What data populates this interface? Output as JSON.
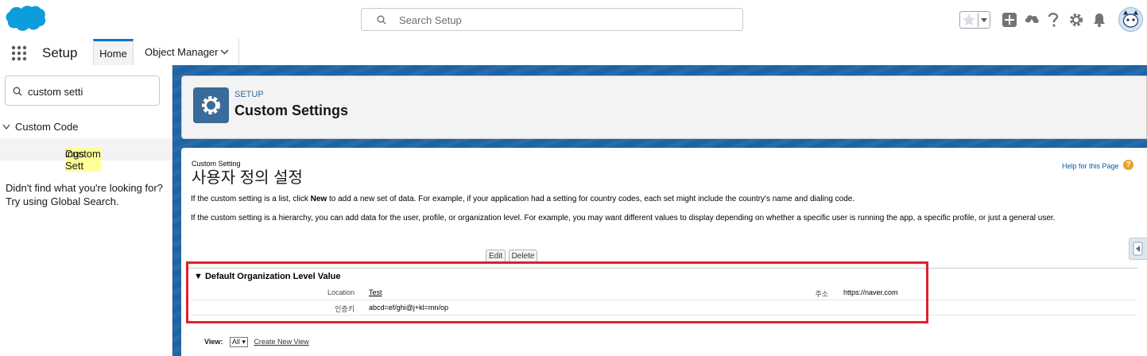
{
  "header": {
    "search_placeholder": "Search Setup",
    "icons": [
      "favorites-star-icon",
      "favorites-dropdown-icon",
      "add-icon",
      "trailhead-icon",
      "help-icon",
      "setup-gear-icon",
      "notifications-bell-icon",
      "user-avatar"
    ]
  },
  "nav": {
    "app_title": "Setup",
    "tabs": [
      {
        "label": "Home",
        "active": true
      },
      {
        "label": "Object Manager",
        "active": false
      }
    ]
  },
  "sidebar": {
    "quickfind_value": "custom setti",
    "tree": {
      "parent": "Custom Code",
      "child_highlight": "Custom Sett",
      "child_rest": "ings"
    },
    "notfound_line1": "Didn't find what you're looking for?",
    "notfound_line2": "Try using Global Search."
  },
  "page_header": {
    "eyebrow": "SETUP",
    "title": "Custom Settings"
  },
  "content": {
    "small_title": "Custom Setting",
    "big_title": "사용자 정의 설정",
    "help_link": "Help for this Page",
    "para1_pre": "If the custom setting is a list, click ",
    "para1_bold": "New",
    "para1_post": " to add a new set of data. For example, if your application had a setting for country codes, each set might include the country's name and dialing code.",
    "para2": "If the custom setting is a hierarchy, you can add data for the user, profile, or organization level. For example, you may want different values to display depending on whether a specific user is running the app, a specific profile, or just a general user.",
    "edit_button": "Edit",
    "delete_button": "Delete",
    "section_title": "Default Organization Level Value",
    "fields": {
      "location_label": "Location",
      "location_value": "Test",
      "address_label": "주소",
      "address_value": "https://naver.com",
      "authkey_label": "인증키",
      "authkey_value": "abcd=ef/ghi@j+kl=mn/op"
    },
    "view_label": "View:",
    "view_selected": "All",
    "create_view_link": "Create New View"
  },
  "colors": {
    "brand_blue": "#1e63a4",
    "highlight_red": "#e0202d",
    "link_blue": "#015ba7"
  }
}
